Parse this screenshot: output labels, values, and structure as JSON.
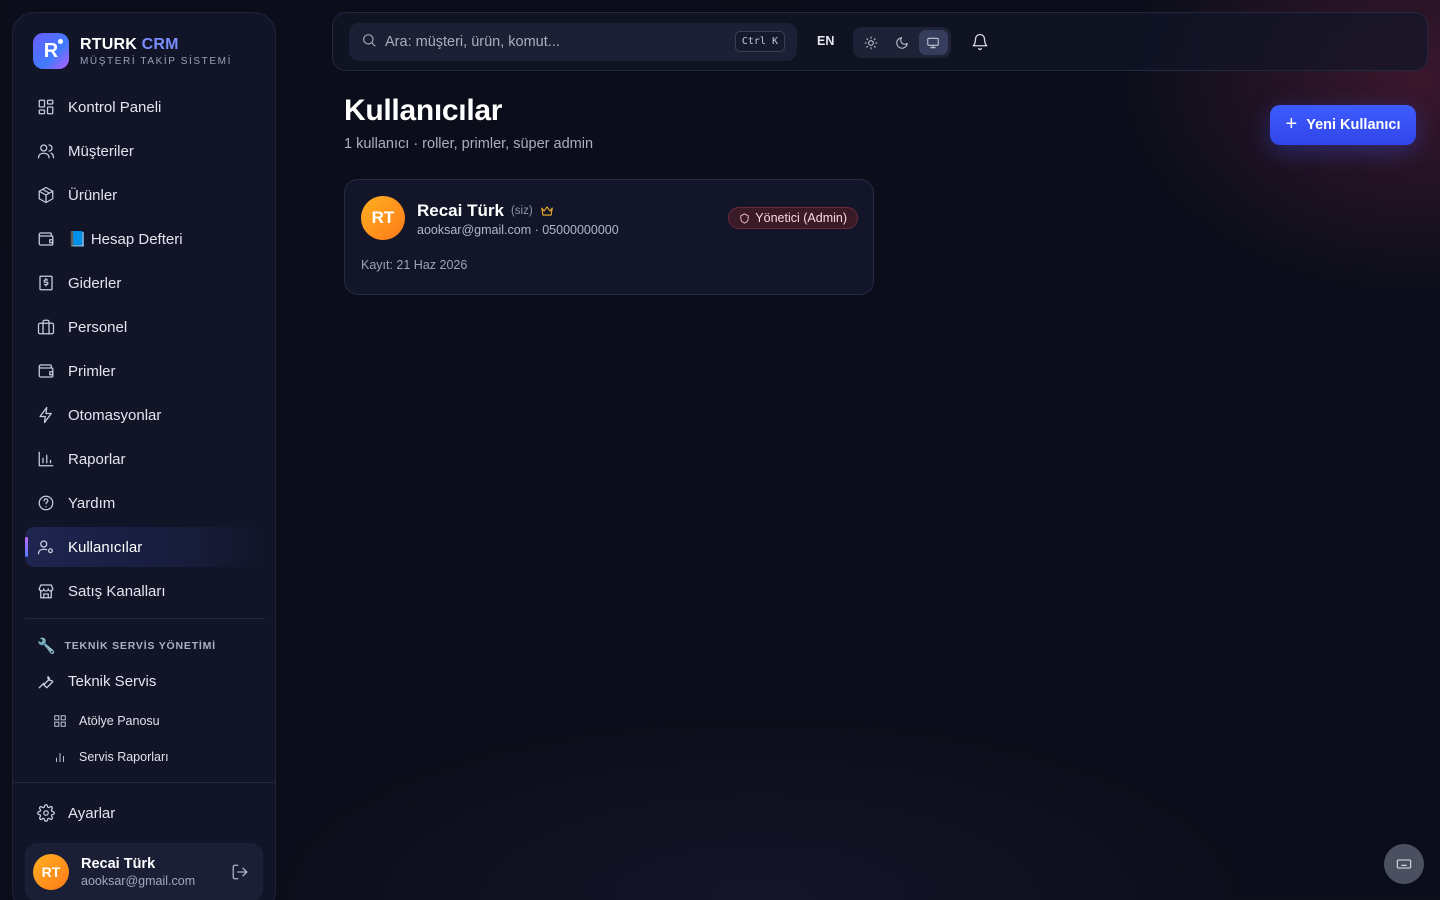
{
  "brand": {
    "name": "RTURK",
    "name_accent": "CRM",
    "subtitle": "MÜŞTERİ TAKİP SİSTEMİ",
    "logo_letter": "R"
  },
  "sidebar": {
    "items": [
      {
        "label": "Kontrol Paneli",
        "icon": "dashboard-icon"
      },
      {
        "label": "Müşteriler",
        "icon": "users-icon"
      },
      {
        "label": "Ürünler",
        "icon": "package-icon"
      },
      {
        "label": "📘 Hesap Defteri",
        "icon": "wallet-icon"
      },
      {
        "label": "Giderler",
        "icon": "receipt-icon"
      },
      {
        "label": "Personel",
        "icon": "briefcase-icon"
      },
      {
        "label": "Primler",
        "icon": "wallet-icon"
      },
      {
        "label": "Otomasyonlar",
        "icon": "zap-icon"
      },
      {
        "label": "Raporlar",
        "icon": "bar-chart-icon"
      },
      {
        "label": "Yardım",
        "icon": "help-icon"
      },
      {
        "label": "Kullanıcılar",
        "icon": "user-cog-icon",
        "active": true
      },
      {
        "label": "Satış Kanalları",
        "icon": "store-icon"
      }
    ],
    "section_title": "TEKNİK SERVİS YÖNETİMİ",
    "section_emoji": "🔧",
    "service": {
      "label": "Teknik Servis",
      "icon": "wrench-icon"
    },
    "sub_items": [
      {
        "label": "Atölye Panosu",
        "icon": "grid-icon"
      },
      {
        "label": "Servis Raporları",
        "icon": "bar-chart-icon"
      }
    ],
    "settings": {
      "label": "Ayarlar",
      "icon": "gear-icon"
    },
    "user": {
      "initials": "RT",
      "name": "Recai Türk",
      "email": "aooksar@gmail.com"
    }
  },
  "topbar": {
    "search_placeholder": "Ara: müşteri, ürün, komut...",
    "shortcut": "Ctrl K",
    "language": "EN",
    "theme_active": "system"
  },
  "main": {
    "title": "Kullanıcılar",
    "subtitle": "1 kullanıcı · roller, primler, süper admin",
    "new_button": "Yeni Kullanıcı",
    "users": [
      {
        "initials": "RT",
        "name": "Recai Türk",
        "you_label": "(siz)",
        "contact": "aooksar@gmail.com · 05000000000",
        "role": "Yönetici (Admin)",
        "registered": "Kayıt: 21 Haz 2026"
      }
    ]
  },
  "colors": {
    "accent": "#3d5cff",
    "background": "#0b0e1a",
    "sidebar": "#111527",
    "avatar": "#ff9a1a",
    "role_badge": "#3a1a26"
  }
}
